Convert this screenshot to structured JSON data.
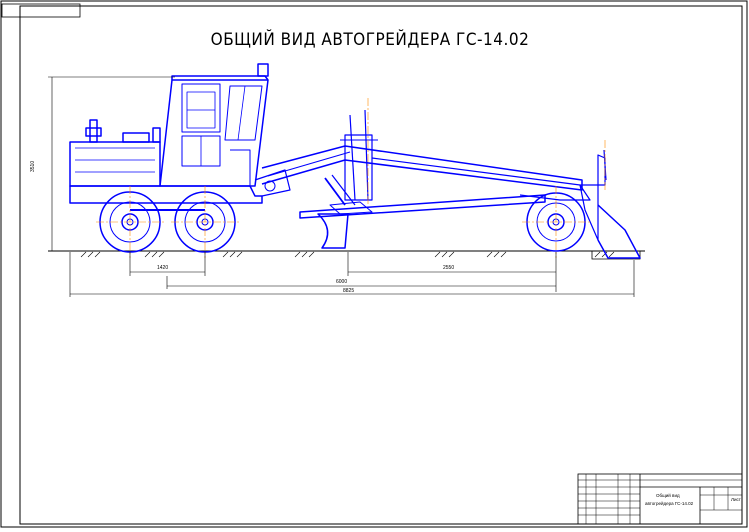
{
  "drawing": {
    "title": "ОБЩИЙ ВИД АВТОГРЕЙДЕРА ГС-14.02",
    "dimensions": {
      "height": "3510",
      "tandem_base": "1420",
      "blade_to_front": "2550",
      "wheelbase": "6000",
      "overall_length": "8825"
    }
  },
  "title_block": {
    "name_line1": "Общий вид",
    "name_line2": "автогрейдера ГС-14.02",
    "sheet_label": "Лист"
  },
  "colors": {
    "machine": "#0000ff",
    "frame": "#000000",
    "axis": "#ff8c00"
  }
}
